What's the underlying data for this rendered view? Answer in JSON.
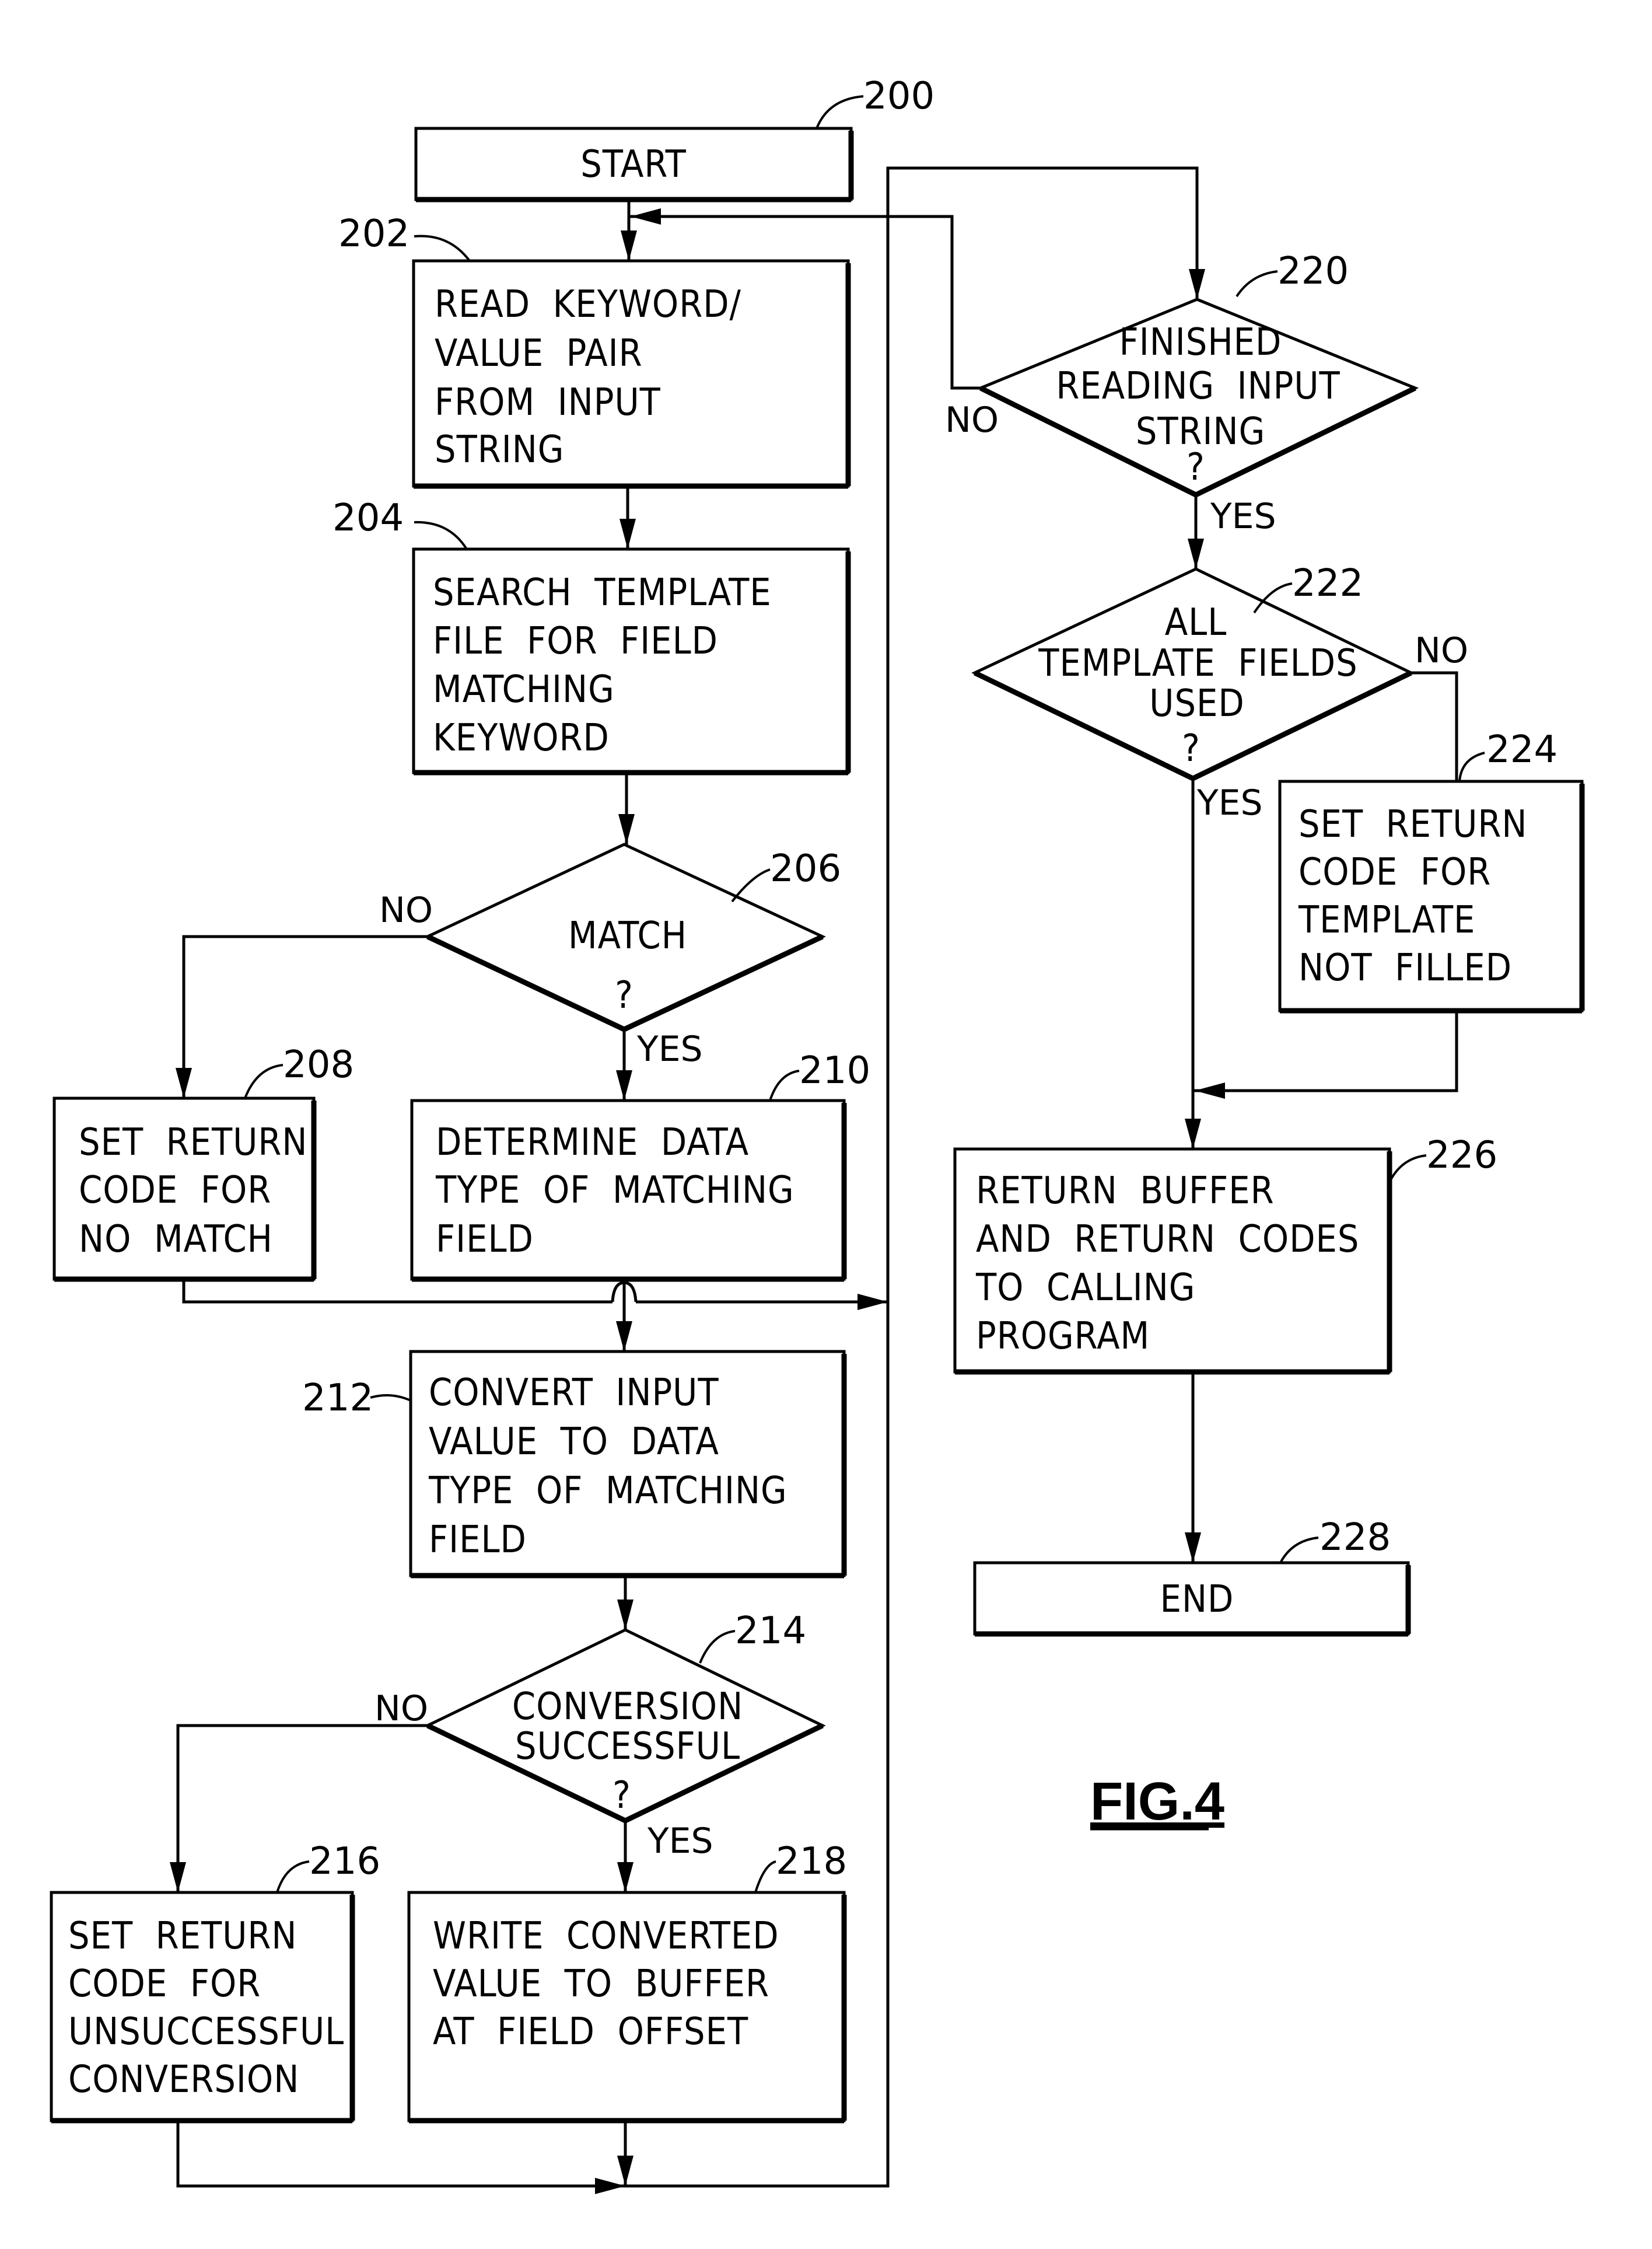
{
  "figure": {
    "title": "FIG.4",
    "nodes": [
      {
        "id": "200",
        "ref": "200",
        "type": "terminal",
        "lines": [
          "START"
        ]
      },
      {
        "id": "202",
        "ref": "202",
        "type": "process",
        "lines": [
          "READ  KEYWORD/",
          "VALUE  PAIR",
          "FROM  INPUT",
          "STRING"
        ]
      },
      {
        "id": "204",
        "ref": "204",
        "type": "process",
        "lines": [
          "SEARCH  TEMPLATE",
          "FILE  FOR  FIELD",
          "MATCHING",
          "KEYWORD"
        ]
      },
      {
        "id": "206",
        "ref": "206",
        "type": "decision",
        "lines": [
          "MATCH",
          "?"
        ]
      },
      {
        "id": "208",
        "ref": "208",
        "type": "process",
        "lines": [
          "SET  RETURN",
          "CODE  FOR",
          "NO  MATCH"
        ]
      },
      {
        "id": "210",
        "ref": "210",
        "type": "process",
        "lines": [
          "DETERMINE  DATA",
          "TYPE  OF  MATCHING",
          "FIELD"
        ]
      },
      {
        "id": "212",
        "ref": "212",
        "type": "process",
        "lines": [
          "CONVERT  INPUT",
          "VALUE  TO  DATA",
          "TYPE  OF  MATCHING",
          "FIELD"
        ]
      },
      {
        "id": "214",
        "ref": "214",
        "type": "decision",
        "lines": [
          "CONVERSION",
          "SUCCESSFUL",
          "?"
        ]
      },
      {
        "id": "216",
        "ref": "216",
        "type": "process",
        "lines": [
          "SET  RETURN",
          "CODE  FOR",
          "UNSUCCESSFUL",
          "CONVERSION"
        ]
      },
      {
        "id": "218",
        "ref": "218",
        "type": "process",
        "lines": [
          "WRITE  CONVERTED",
          "VALUE  TO  BUFFER",
          "AT  FIELD  OFFSET"
        ]
      },
      {
        "id": "220",
        "ref": "220",
        "type": "decision",
        "lines": [
          "FINISHED",
          "READING  INPUT",
          "STRING",
          "?"
        ]
      },
      {
        "id": "222",
        "ref": "222",
        "type": "decision",
        "lines": [
          "ALL",
          "TEMPLATE  FIELDS",
          "USED",
          "?"
        ]
      },
      {
        "id": "224",
        "ref": "224",
        "type": "process",
        "lines": [
          "SET  RETURN",
          "CODE  FOR",
          "TEMPLATE",
          "NOT  FILLED"
        ]
      },
      {
        "id": "226",
        "ref": "226",
        "type": "process",
        "lines": [
          "RETURN  BUFFER",
          "AND  RETURN  CODES",
          "TO  CALLING",
          "PROGRAM"
        ]
      },
      {
        "id": "228",
        "ref": "228",
        "type": "terminal",
        "lines": [
          "END"
        ]
      }
    ],
    "branch_labels": {
      "206_no": "NO",
      "206_yes": "YES",
      "214_no": "NO",
      "214_yes": "YES",
      "220_no": "NO",
      "220_yes": "YES",
      "222_no": "NO",
      "222_yes": "YES"
    },
    "edges": [
      {
        "from": "200",
        "to": "202"
      },
      {
        "from": "202",
        "to": "204"
      },
      {
        "from": "204",
        "to": "206"
      },
      {
        "from": "206",
        "to": "208",
        "label": "NO"
      },
      {
        "from": "206",
        "to": "210",
        "label": "YES"
      },
      {
        "from": "208",
        "to": "220"
      },
      {
        "from": "210",
        "to": "212"
      },
      {
        "from": "212",
        "to": "214"
      },
      {
        "from": "214",
        "to": "216",
        "label": "NO"
      },
      {
        "from": "214",
        "to": "218",
        "label": "YES"
      },
      {
        "from": "216",
        "to": "220"
      },
      {
        "from": "218",
        "to": "220"
      },
      {
        "from": "220",
        "to": "202",
        "label": "NO"
      },
      {
        "from": "220",
        "to": "222",
        "label": "YES"
      },
      {
        "from": "222",
        "to": "224",
        "label": "NO"
      },
      {
        "from": "222",
        "to": "226",
        "label": "YES"
      },
      {
        "from": "224",
        "to": "226"
      },
      {
        "from": "226",
        "to": "228"
      }
    ]
  }
}
